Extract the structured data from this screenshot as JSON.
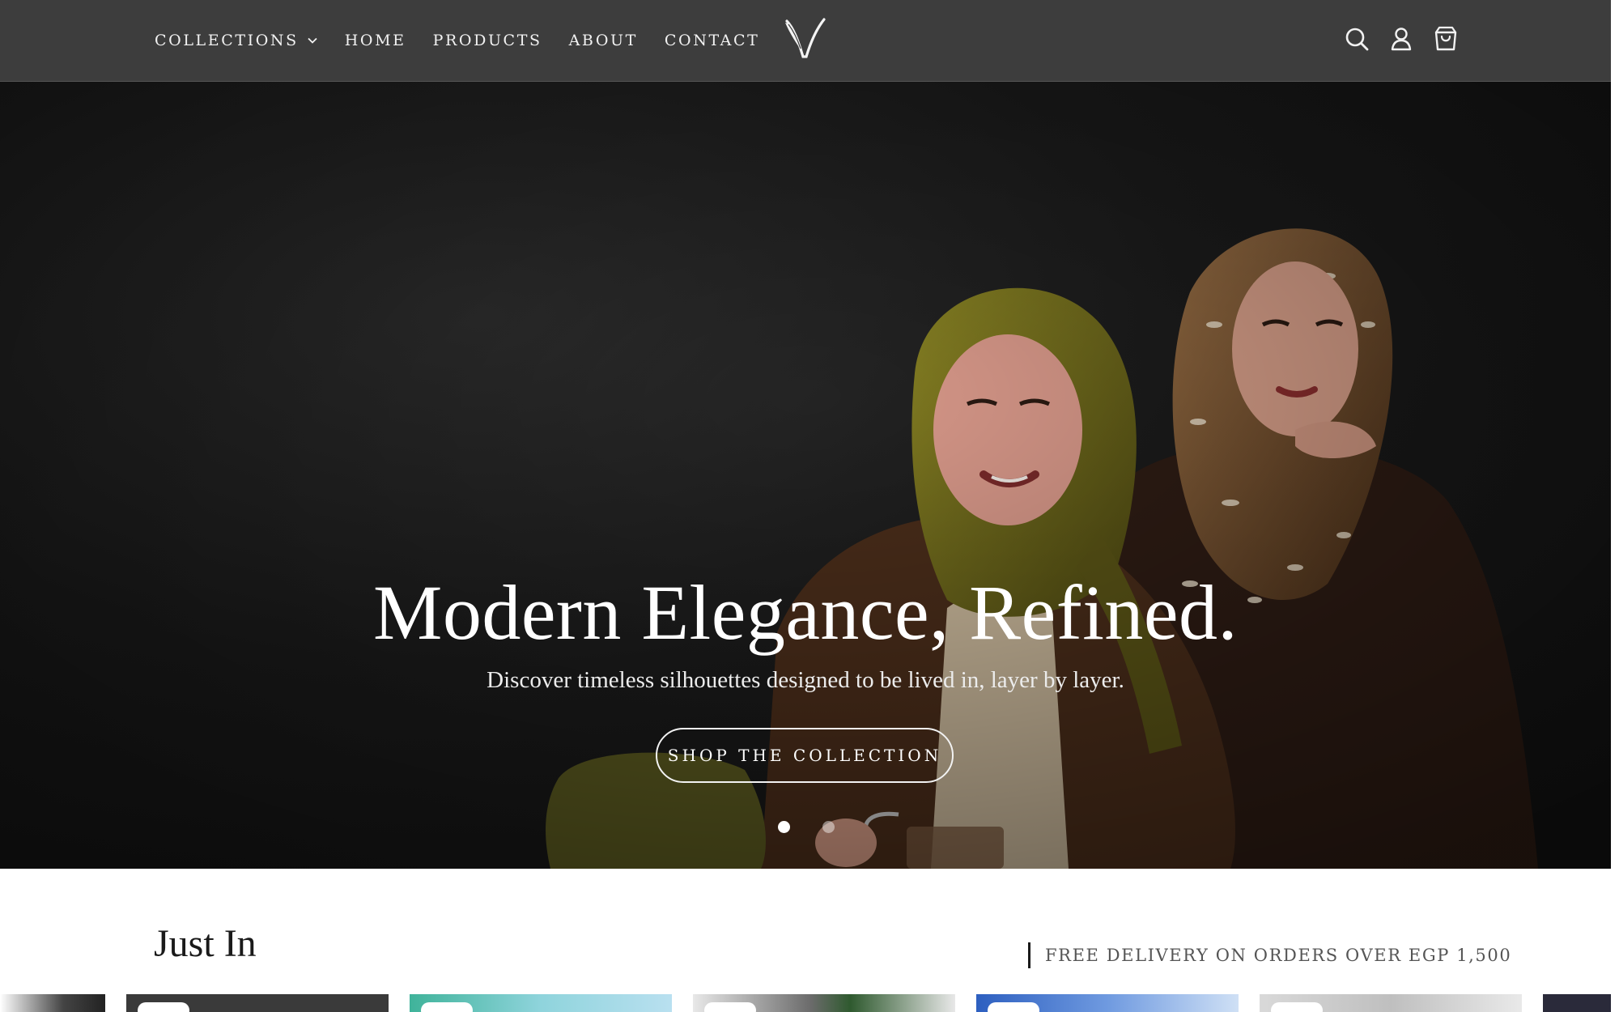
{
  "header": {
    "nav": [
      {
        "label": "COLLECTIONS"
      },
      {
        "label": "HOME"
      },
      {
        "label": "PRODUCTS"
      },
      {
        "label": "ABOUT"
      },
      {
        "label": "CONTACT"
      }
    ],
    "icons": [
      "search-icon",
      "account-icon",
      "cart-icon"
    ]
  },
  "hero": {
    "title": "Modern Elegance, Refined.",
    "subtitle": "Discover timeless silhouettes designed to be lived in, layer by layer.",
    "cta": "SHOP THE COLLECTION",
    "slides_total": 2,
    "active_slide": 1
  },
  "just_in": {
    "heading": "Just In",
    "promo": "FREE DELIVERY ON ORDERS OVER EGP 1,500"
  },
  "colors": {
    "header_bg": "#3d3d3d",
    "hero_bg": "#1b1b1b",
    "scarf_olive": "#6b6a1c",
    "scarf_brown": "#6b4a2a",
    "jacket": "#4a2d1a"
  }
}
